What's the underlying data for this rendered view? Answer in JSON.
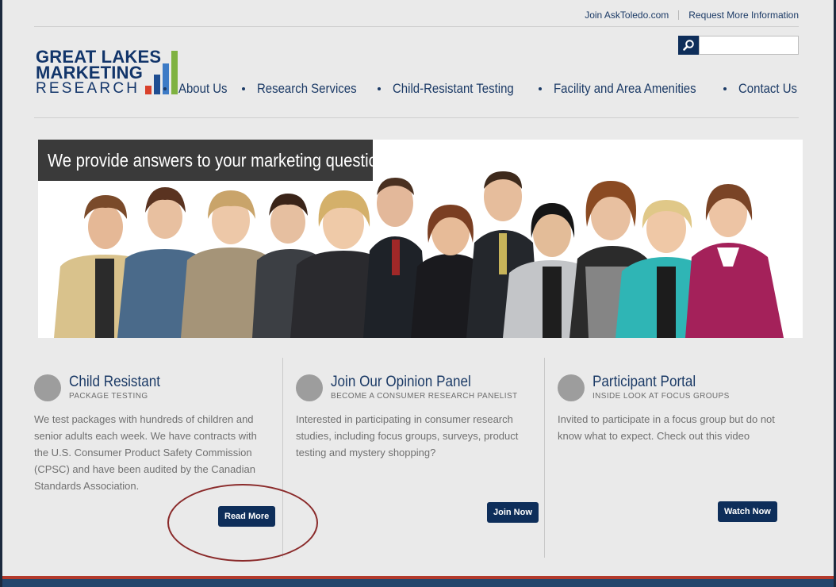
{
  "header": {
    "util_links": [
      "Join AskToledo.com",
      "Request More Information"
    ],
    "search": {
      "placeholder": ""
    }
  },
  "logo": {
    "line1": "GREAT LAKES",
    "line2": "MARKETING",
    "line3": "RESEARCH"
  },
  "nav": {
    "items": [
      "About Us",
      "Research Services",
      "Child-Resistant Testing",
      "Facility and Area Amenities",
      "Contact Us"
    ]
  },
  "hero": {
    "banner_text": "We provide answers to your marketing questions"
  },
  "columns": [
    {
      "title": "Child Resistant",
      "subtitle": "PACKAGE TESTING",
      "text": "We test packages with hundreds of children and senior adults each week. We have contracts with the U.S. Consumer Product Safety Commission (CPSC) and have been audited by the Canadian Standards Association.",
      "button": "Read More"
    },
    {
      "title": "Join Our Opinion Panel",
      "subtitle": "BECOME A CONSUMER RESEARCH PANELIST",
      "text": "Interested in participating in consumer research studies, including focus groups, surveys, product testing and mystery shopping?",
      "button": "Join Now"
    },
    {
      "title": "Participant Portal",
      "subtitle": "INSIDE LOOK AT FOCUS GROUPS",
      "text": "Invited to participate in a focus group but do not know what to expect. Check out this video",
      "button": "Watch Now"
    }
  ],
  "colors": {
    "brand_navy": "#0e2e5a",
    "link_blue": "#1b3a66",
    "annotation_oval": "#8a2a2a",
    "footer_red": "#b33a2c",
    "footer_blue": "#23466c"
  }
}
